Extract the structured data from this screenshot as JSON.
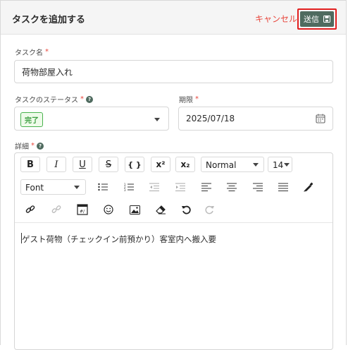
{
  "header": {
    "title": "タスクを追加する",
    "cancel_label": "キャンセル",
    "submit_label": "送信"
  },
  "fields": {
    "task_name": {
      "label": "タスク名",
      "required_mark": "*",
      "value": "荷物部屋入れ"
    },
    "status": {
      "label": "タスクのステータス",
      "required_mark": "*",
      "help_icon": "?",
      "value": "完了"
    },
    "deadline": {
      "label": "期限",
      "required_mark": "*",
      "value": "2025/07/18"
    },
    "details": {
      "label": "詳細",
      "required_mark": "*",
      "help_icon": "?",
      "content": "ゲスト荷物（チェックイン前預かり）客室内へ搬入要"
    }
  },
  "toolbar": {
    "bold": "B",
    "italic": "I",
    "underline": "U",
    "strike": "S",
    "code": "{ }",
    "superscript": "x²",
    "subscript": "x₂",
    "format_value": "Normal",
    "size_value": "14",
    "font_value": "Font"
  },
  "colors": {
    "accent": "#4f6b5f",
    "danger": "#e8463c",
    "success": "#3a9e3f"
  }
}
